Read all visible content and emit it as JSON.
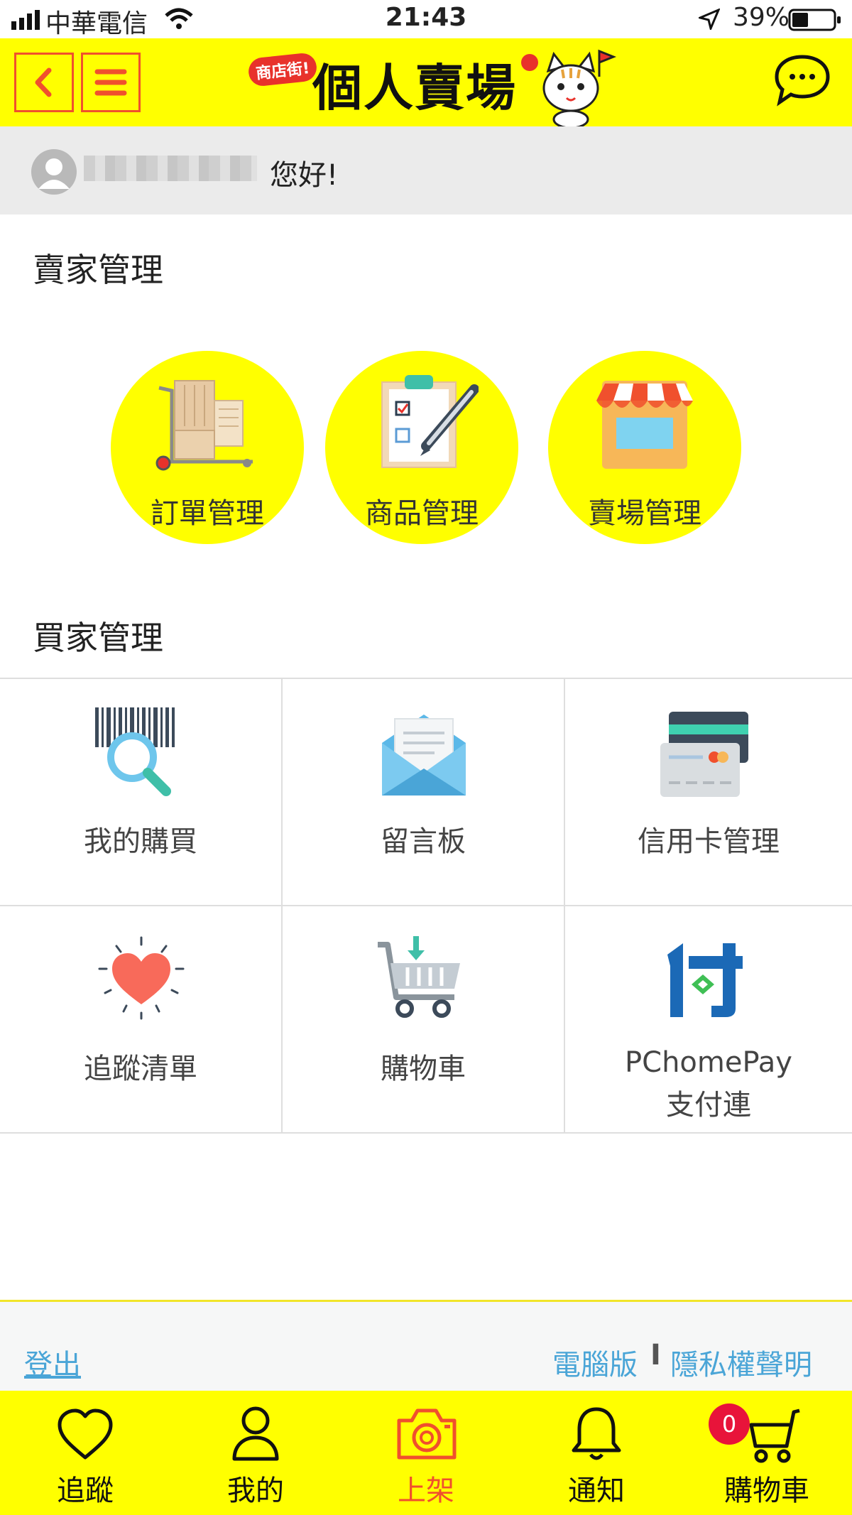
{
  "status_bar": {
    "carrier": "中華電信",
    "time": "21:43",
    "battery": "39%"
  },
  "header": {
    "logo_badge": "商店街!",
    "logo_text": "個人賣場"
  },
  "greeting": {
    "text": "您好!"
  },
  "seller": {
    "title": "賣家管理",
    "items": [
      {
        "label": "訂單管理",
        "icon": "cart-boxes-icon"
      },
      {
        "label": "商品管理",
        "icon": "clipboard-pen-icon"
      },
      {
        "label": "賣場管理",
        "icon": "storefront-icon"
      }
    ]
  },
  "buyer": {
    "title": "買家管理",
    "items": [
      {
        "label": "我的購買",
        "icon": "barcode-search-icon"
      },
      {
        "label": "留言板",
        "icon": "envelope-icon"
      },
      {
        "label": "信用卡管理",
        "icon": "credit-card-icon"
      },
      {
        "label": "追蹤清單",
        "icon": "heart-icon"
      },
      {
        "label": "購物車",
        "icon": "cart-icon"
      },
      {
        "label": "PChomePay",
        "label2": "支付連",
        "icon": "pchomepay-icon"
      }
    ]
  },
  "footer": {
    "logout": "登出",
    "desktop": "電腦版",
    "separator": "I",
    "privacy": "隱私權聲明"
  },
  "tabbar": {
    "tabs": [
      {
        "label": "追蹤",
        "icon": "heart-outline-icon"
      },
      {
        "label": "我的",
        "icon": "person-icon"
      },
      {
        "label": "上架",
        "icon": "camera-icon"
      },
      {
        "label": "通知",
        "icon": "bell-icon"
      },
      {
        "label": "購物車",
        "icon": "cart-outline-icon"
      }
    ],
    "cart_count": "0",
    "active_tab": "上架"
  },
  "colors": {
    "accent": "#ffff00",
    "brand_red": "#f0502d",
    "link": "#4aa5d7"
  }
}
